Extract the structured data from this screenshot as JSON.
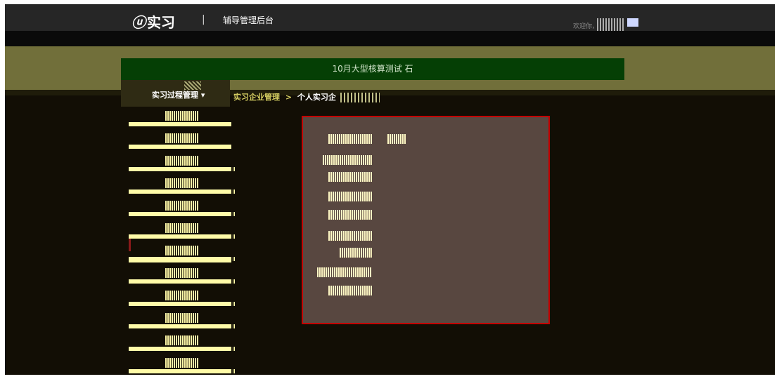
{
  "header": {
    "logo_text": "实习",
    "logo_mark": "ⓤ",
    "separator": "|",
    "admin_title": "辅导管理后台",
    "welcome_text": "欢迎你，"
  },
  "banner": {
    "title": "10月大型核算测试 石"
  },
  "sidebar": {
    "header_label": "实习过程管理 ▾",
    "items": [
      {
        "label": ""
      },
      {
        "label": ""
      },
      {
        "label": ""
      },
      {
        "label": ""
      },
      {
        "label": ""
      },
      {
        "label": ""
      },
      {
        "label": ""
      },
      {
        "label": ""
      },
      {
        "label": ""
      },
      {
        "label": ""
      },
      {
        "label": ""
      },
      {
        "label": ""
      }
    ]
  },
  "breadcrumb": {
    "parent": "实习企业管理",
    "separator": ">",
    "current": "个人实习企"
  },
  "colors": {
    "topbar": "#262626",
    "banner": "#053f05",
    "content_border": "#c40000",
    "sidebar_line": "#fffba8"
  }
}
